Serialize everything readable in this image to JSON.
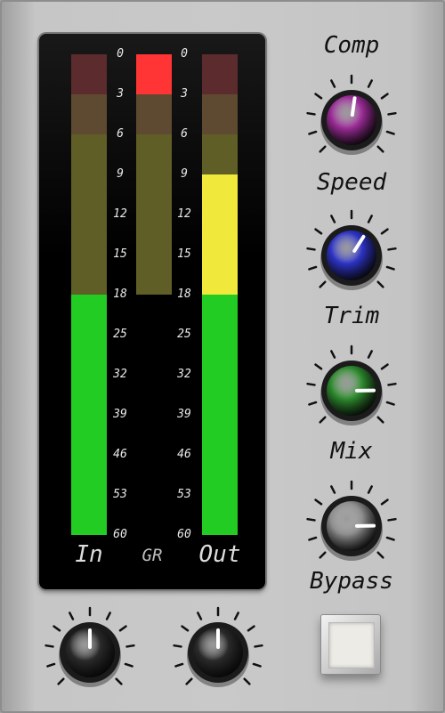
{
  "scale": [
    "0",
    "3",
    "6",
    "9",
    "12",
    "15",
    "18",
    "25",
    "32",
    "39",
    "46",
    "53",
    "60"
  ],
  "meters": {
    "in": {
      "label": "In",
      "level_db": 18
    },
    "gr": {
      "label": "GR",
      "level_db": 18,
      "peak_hold_db": 0
    },
    "out": {
      "label": "Out",
      "level_db": 9
    }
  },
  "colors": {
    "led_green": "#22cc22",
    "led_yellow": "#f0e83a",
    "led_red": "#ff3434",
    "dim_red": "#5c2b2d",
    "dim_amber": "#5e4a30",
    "dim_olive": "#5f5e26",
    "comp_knob": "#9a2b96",
    "speed_knob": "#2d33c4",
    "trim_knob": "#2e8a2e",
    "mix_knob": "#8e8e8e"
  },
  "controls": {
    "comp": {
      "label": "Comp",
      "position": 0.53
    },
    "speed": {
      "label": "Speed",
      "position": 0.62
    },
    "trim": {
      "label": "Trim",
      "position": 0.83
    },
    "mix": {
      "label": "Mix",
      "position": 0.83
    },
    "in_gain": {
      "position": 0.5
    },
    "out_gain": {
      "position": 0.5
    },
    "bypass": {
      "label": "Bypass",
      "engaged": false
    }
  }
}
